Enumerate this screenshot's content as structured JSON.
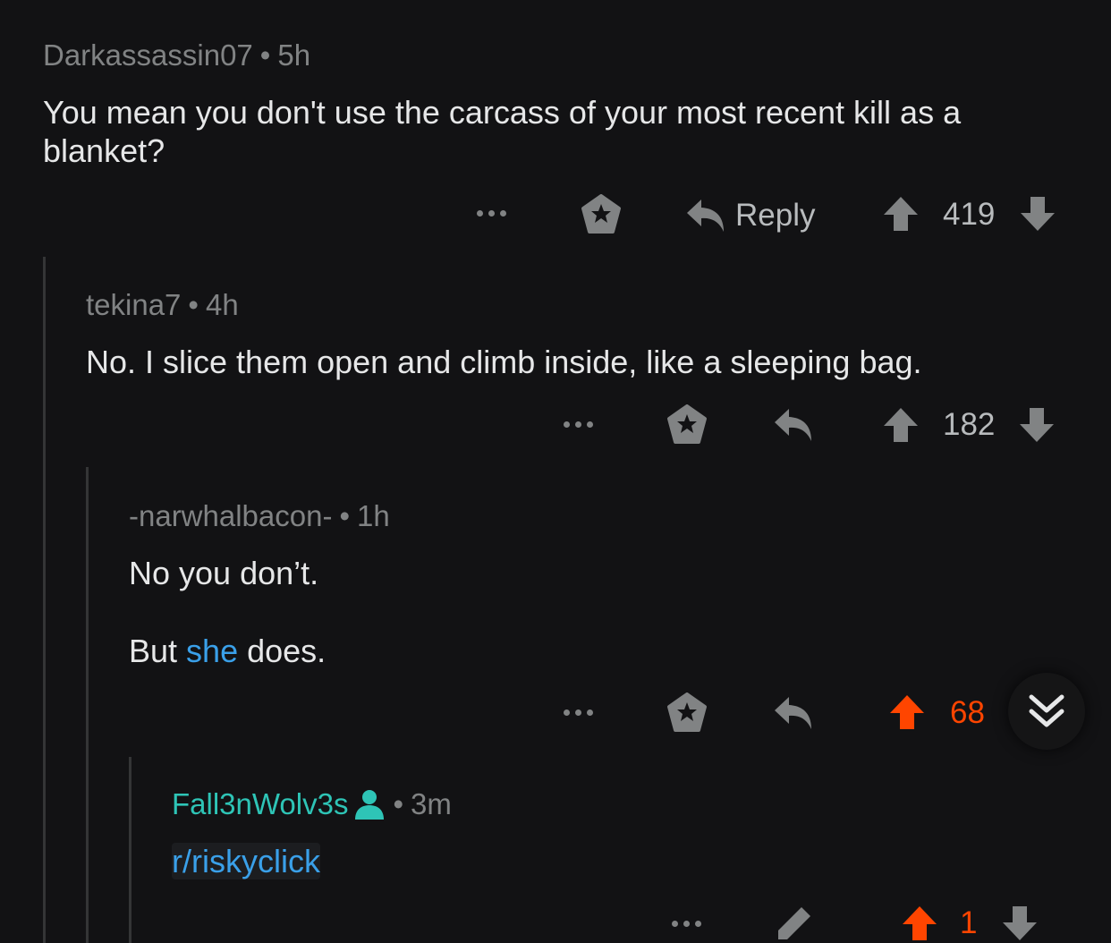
{
  "comments": [
    {
      "author": "Darkassassin07",
      "time": "5h",
      "body": "You mean you don't use the carcass of your most recent kill as a blanket?",
      "reply_label": "Reply",
      "score": "419"
    },
    {
      "author": "tekina7",
      "time": "4h",
      "body": "No. I slice them open and climb inside, like a sleeping bag.",
      "score": "182"
    },
    {
      "author": "-narwhalbacon-",
      "time": "1h",
      "body_line1": "No you don’t.",
      "body_line2_pre": "But ",
      "body_line2_link": "she",
      "body_line2_post": " does.",
      "score": "68"
    },
    {
      "author": "Fall3nWolv3s",
      "time": "3m",
      "body_link": "r/riskyclick",
      "score": "1"
    }
  ],
  "separator": "•",
  "colors": {
    "background": "#121214",
    "upvote": "#ff4500",
    "link": "#3aa0e9",
    "op_author": "#2ec4b6",
    "muted": "#818384"
  },
  "icons": [
    "more-icon",
    "award-icon",
    "reply-icon",
    "upvote-icon",
    "downvote-icon",
    "collapse-icon",
    "edit-icon",
    "user-icon"
  ]
}
